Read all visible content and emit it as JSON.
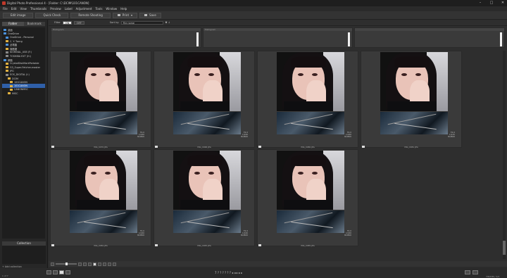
{
  "window": {
    "title": "Digital Photo Professional 4 - [Folder: C:\\DCIM\\101CANON]"
  },
  "menu": [
    "File",
    "Edit",
    "View",
    "Thumbnails",
    "Preview",
    "Label",
    "Adjustment",
    "Tools",
    "Window",
    "Help"
  ],
  "toolbar": {
    "edit_image": "Edit image",
    "quick_check": "Quick Check",
    "remote_shooting": "Remote Shooting",
    "print": "Print",
    "save": "Save"
  },
  "left_panel": {
    "tabs": [
      "Folder",
      "Bookmark"
    ],
    "tree": [
      {
        "label": "桌面",
        "color": "#4a90d9"
      },
      {
        "label": "OneDrive",
        "color": "#4a90d9"
      },
      {
        "label": "OneDrive - Personal",
        "color": "#4a90d9"
      },
      {
        "label": "C. Y. Tseng",
        "color": "#e0b040"
      },
      {
        "label": "此電腦",
        "color": "#4a90d9"
      },
      {
        "label": "媒體櫃",
        "color": "#e0b040"
      },
      {
        "label": "KIORINAL_USB (F:)",
        "color": "#888888"
      },
      {
        "label": "TOSHIBA EXT (H:)",
        "color": "#888888"
      },
      {
        "label": "網路",
        "color": "#4a90d9"
      },
      {
        "label": "CrystalDiskMarkPortable",
        "color": "#e0b040"
      },
      {
        "label": "G3_Super-Fetcher-master",
        "color": "#e0b040"
      },
      {
        "label": "JPG",
        "color": "#e0b040"
      },
      {
        "label": "EOS_DIGITAL (I:)",
        "color": "#888888"
      },
      {
        "label": "DCIM",
        "color": "#e0b040"
      },
      {
        "label": "100CANON",
        "color": "#e0b040"
      },
      {
        "label": "101CANON",
        "color": "#e0b040",
        "selected": true
      },
      {
        "label": "CANONMSC",
        "color": "#e0b040"
      },
      {
        "label": "MISC",
        "color": "#e0b040"
      }
    ],
    "collection_label": "Collection",
    "add_collection": "Add collection"
  },
  "filter": {
    "filter_label": "Filter",
    "on": "ON",
    "off": "OFF",
    "sort_label": "Sort by",
    "sort_value": "File name",
    "order": "▼ ↓",
    "hist_labels": [
      "Histogram",
      "Histogram",
      ""
    ]
  },
  "thumbnails": [
    {
      "name": "IMG_0070.JPG",
      "meta": [
        "F4.0",
        "1/160",
        "ISO800"
      ]
    },
    {
      "name": "IMG_0068.JPG",
      "meta": [
        "F4.0",
        "1/160",
        "ISO800"
      ]
    },
    {
      "name": "IMG_0080.JPG",
      "meta": [
        "F4.0",
        "1/160",
        "ISO800"
      ]
    },
    {
      "name": "IMG_0081.JPG",
      "meta": [
        "F4.0",
        "1/125",
        "ISO800"
      ]
    },
    {
      "name": "IMG_0082.JPG",
      "meta": [
        "F4.0",
        "1/160",
        "ISO800"
      ]
    },
    {
      "name": "IMG_0083.JPG",
      "meta": [
        "F4.0",
        "1/160",
        "ISO800"
      ]
    },
    {
      "name": "IMG_0085.JPG",
      "meta": [
        "F4.0",
        "1/160",
        "ISO800"
      ]
    }
  ],
  "status": {
    "left": "1 of 7",
    "center": "7 ? ? ? ? ? ?  ◂ ◂ ▸ ▸ ▸",
    "count": "7/6/100 / 1/1"
  }
}
